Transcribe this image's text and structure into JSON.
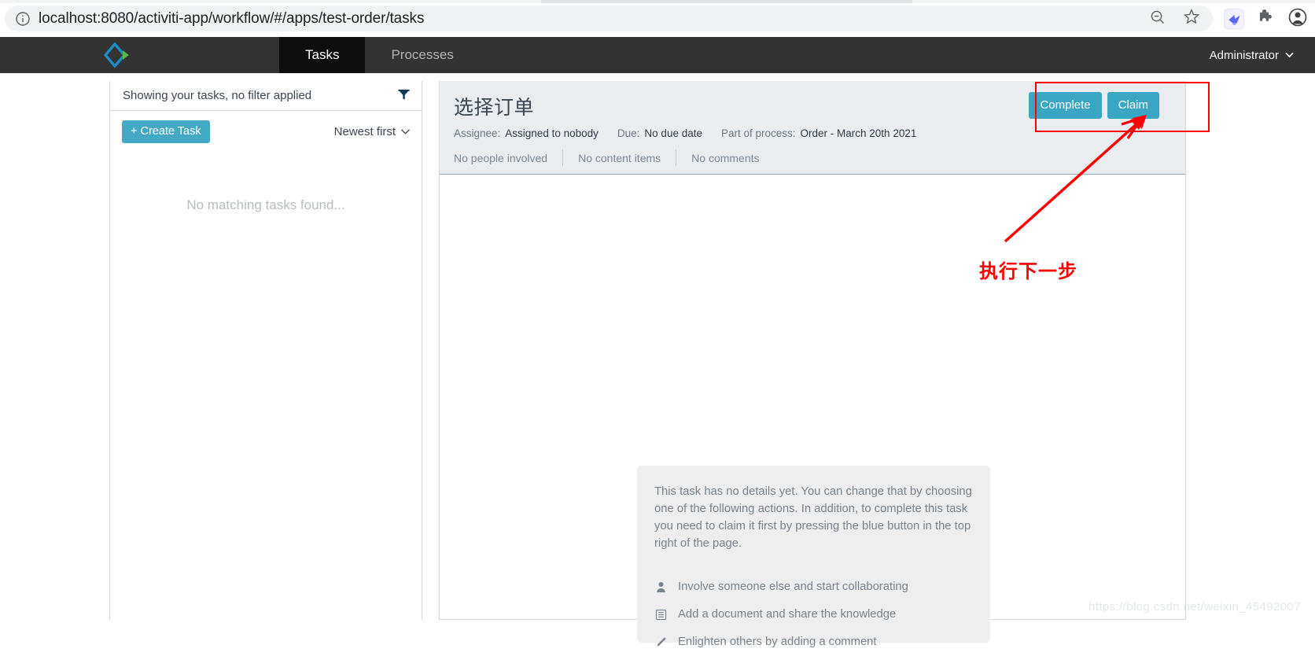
{
  "browser": {
    "url": "localhost:8080/activiti-app/workflow/#/apps/test-order/tasks",
    "site_info_icon": "info-circle-icon",
    "zoom_out_icon": "magnifier-minus-icon",
    "bookmark_icon": "star-outline-icon",
    "extension_icon": "bird-extension-icon",
    "extensions_puzzle_icon": "puzzle-piece-icon",
    "profile_icon": "account-avatar-icon",
    "chrome_icon_color": "#5f6368",
    "omnibox_background": "#f1f3f4"
  },
  "app_header": {
    "logo_icon": "activiti-diamond-logo",
    "logo_colors": {
      "outline": "#1a8cc9",
      "accent": "#57b747"
    },
    "background": "#333333",
    "nav_tabs": [
      {
        "label": "Tasks",
        "active": true
      },
      {
        "label": "Processes",
        "active": false
      }
    ],
    "user_menu": {
      "label": "Administrator",
      "caret_icon": "chevron-down-icon"
    }
  },
  "task_list": {
    "filter_header_label": "Showing your tasks, no filter applied",
    "filter_icon": "filter-funnel-icon",
    "create_task_label": "+ Create Task",
    "create_task_color": "#43a9c4",
    "sort_label": "Newest first",
    "sort_caret_icon": "chevron-down-icon",
    "empty_message": "No matching tasks found..."
  },
  "task_details": {
    "title": "选择订单",
    "meta": [
      {
        "label": "Assignee:",
        "value": "Assigned to nobody"
      },
      {
        "label": "Due:",
        "value": "No due date"
      },
      {
        "label": "Part of process:",
        "value": "Order - March 20th 2021"
      }
    ],
    "tabs": [
      {
        "label": "No people involved"
      },
      {
        "label": "No content items"
      },
      {
        "label": "No comments"
      }
    ],
    "actions": [
      {
        "label": "Complete",
        "name": "complete-button"
      },
      {
        "label": "Claim",
        "name": "claim-button"
      }
    ],
    "action_button_color": "#39a7c4",
    "header_background": "#e9edf0",
    "no_details_text": "This task has no details yet. You can change that by choosing one of the following actions. In addition, to complete this task you need to claim it first by pressing the blue button in the top right of the page.",
    "suggested_actions": [
      {
        "icon": "person-icon",
        "label": "Involve someone else and start collaborating"
      },
      {
        "icon": "document-icon",
        "label": "Add a document and share the knowledge"
      },
      {
        "icon": "pencil-icon",
        "label": "Enlighten others by adding a comment"
      }
    ]
  },
  "annotation": {
    "caption": "执行下一步",
    "color": "#fc0000",
    "arrow_icon": "arrow-pointer-icon",
    "highlight_box_target": "claim-and-complete-buttons"
  },
  "watermark": {
    "text": "https://blog.csdn.net/weixin_45492007"
  }
}
